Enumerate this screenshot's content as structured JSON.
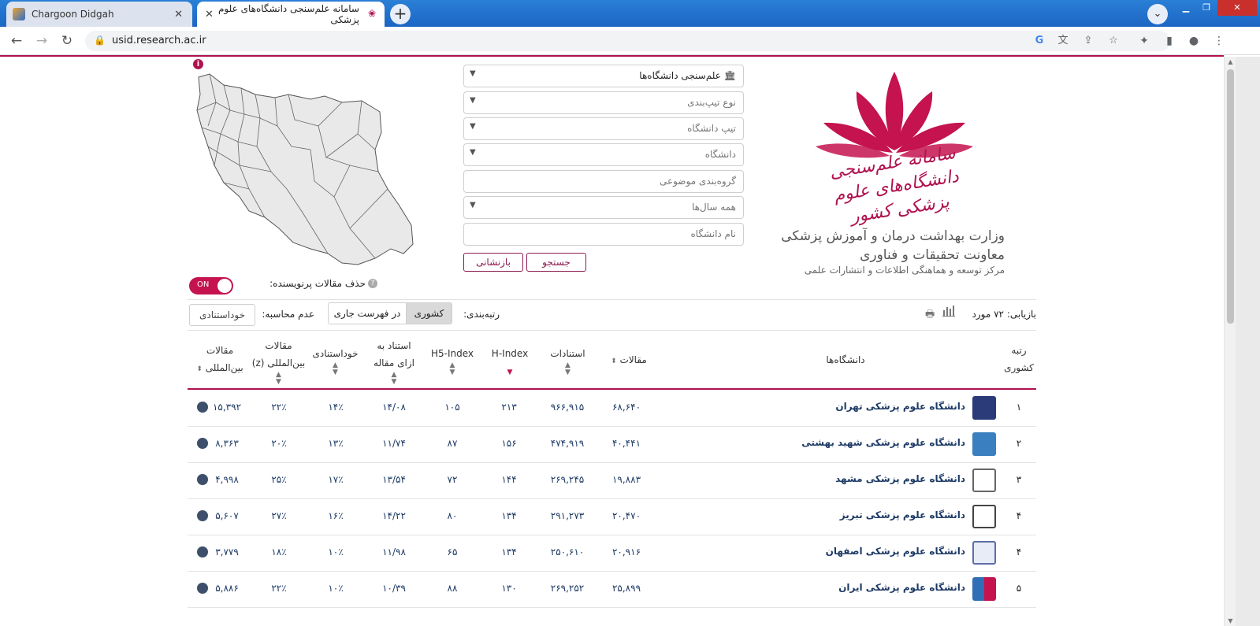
{
  "browser": {
    "tabs": [
      {
        "title": "Chargoon Didgah",
        "active": false
      },
      {
        "title": "سامانه علم‌سنجی دانشگاه‌های علوم پزشکی",
        "active": true
      }
    ],
    "url": "usid.research.ac.ir",
    "icons": [
      "back-icon",
      "forward-icon",
      "reload-icon",
      "lock-icon",
      "google-icon",
      "translate-icon",
      "share-icon",
      "star-icon",
      "extensions-icon",
      "sidepanel-icon",
      "profile-icon",
      "menu-icon"
    ]
  },
  "header": {
    "logo_text": "سامانه علم‌سنجی دانشگاه‌های علوم پزشکی کشور",
    "ministry_line1": "وزارت بهداشت درمان و آموزش پزشکی",
    "ministry_line2": "معاونت تحقیقات و فناوری",
    "ministry_line3": "مرکز توسعه و هماهنگی اطلاعات و انتشارات علمی",
    "brand_color": "#b0124f"
  },
  "filters": {
    "system": "علم‌سنجی دانشگاه‌ها",
    "classification_type": "نوع تیپ‌بندی",
    "university_type": "تیپ دانشگاه",
    "university": "دانشگاه",
    "subject_group": "گروه‌بندی موضوعی",
    "years": "همه سال‌ها",
    "university_name": "نام دانشگاه",
    "search_label": "جستجو",
    "reset_label": "بازنشانی"
  },
  "options": {
    "exclude_label": "حذف مقالات پرنویسنده:",
    "toggle_state": "ON",
    "ranking_label": "رتبه‌بندی:",
    "ranking_national": "کشوری",
    "ranking_current": "در فهرست جاری",
    "not_counting_label": "عدم محاسبه:",
    "self_citation_btn": "خوداستنادی",
    "found_label": "بازیابی: ۷۲ مورد"
  },
  "table": {
    "headers": {
      "rank_line1": "رتبه",
      "rank_line2": "کشوری",
      "universities": "دانشگاه‌ها",
      "articles": "مقالات",
      "citations": "استنادات",
      "hindex": "H-Index",
      "h5index": "H5-Index",
      "cpa_line1": "استناد به",
      "cpa_line2": "ازای مقاله",
      "self_citation": "خوداستنادی",
      "intl_z_line1": "مقالات",
      "intl_z_line2": "بین‌المللی (z)",
      "intl_line1": "مقالات",
      "intl_line2": "بین‌المللی"
    },
    "rows": [
      {
        "rank": "۱",
        "name": "دانشگاه علوم پزشکی تهران",
        "articles": "۶۸,۶۴۰",
        "citations": "۹۶۶,۹۱۵",
        "hindex": "۲۱۳",
        "h5index": "۱۰۵",
        "cpa": "۱۴/۰۸",
        "self": "۱۴٪",
        "intl_z": "۲۲٪",
        "intl": "۱۵,۳۹۲",
        "logo_color": "#2b3a78"
      },
      {
        "rank": "۲",
        "name": "دانشگاه علوم پزشکی شهید بهشتی",
        "articles": "۴۰,۴۴۱",
        "citations": "۴۷۴,۹۱۹",
        "hindex": "۱۵۶",
        "h5index": "۸۷",
        "cpa": "۱۱/۷۴",
        "self": "۱۳٪",
        "intl_z": "۲۰٪",
        "intl": "۸,۳۶۳",
        "logo_color": "#3a7fbf"
      },
      {
        "rank": "۳",
        "name": "دانشگاه علوم پزشکی مشهد",
        "articles": "۱۹,۸۸۳",
        "citations": "۲۶۹,۲۴۵",
        "hindex": "۱۴۴",
        "h5index": "۷۲",
        "cpa": "۱۳/۵۴",
        "self": "۱۷٪",
        "intl_z": "۲۵٪",
        "intl": "۴,۹۹۸",
        "logo_color": "#666666"
      },
      {
        "rank": "۴",
        "name": "دانشگاه علوم پزشکی تبریز",
        "articles": "۲۰,۴۷۰",
        "citations": "۲۹۱,۲۷۳",
        "hindex": "۱۳۴",
        "h5index": "۸۰",
        "cpa": "۱۴/۲۲",
        "self": "۱۶٪",
        "intl_z": "۲۷٪",
        "intl": "۵,۶۰۷",
        "logo_color": "#444444"
      },
      {
        "rank": "۴",
        "name": "دانشگاه علوم پزشکی اصفهان",
        "articles": "۲۰,۹۱۶",
        "citations": "۲۵۰,۶۱۰",
        "hindex": "۱۳۴",
        "h5index": "۶۵",
        "cpa": "۱۱/۹۸",
        "self": "۱۰٪",
        "intl_z": "۱۸٪",
        "intl": "۳,۷۷۹",
        "logo_color": "#5d6ea8"
      },
      {
        "rank": "۵",
        "name": "دانشگاه علوم پزشکی ایران",
        "articles": "۲۵,۸۹۹",
        "citations": "۲۶۹,۲۵۲",
        "hindex": "۱۳۰",
        "h5index": "۸۸",
        "cpa": "۱۰/۳۹",
        "self": "۱۰٪",
        "intl_z": "۲۲٪",
        "intl": "۵,۸۸۶",
        "logo_color": "#2f6fb5"
      }
    ]
  }
}
